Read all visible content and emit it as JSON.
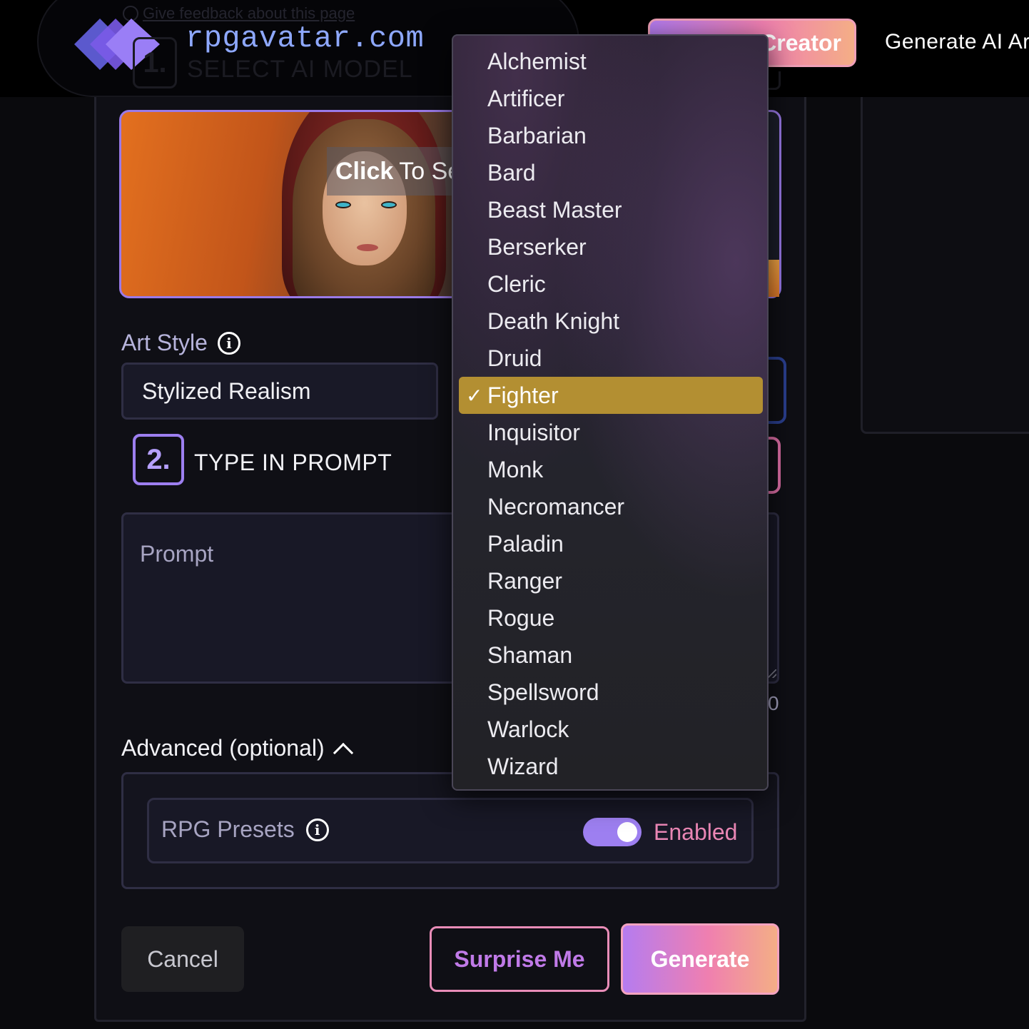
{
  "header": {
    "feedback_link": "Give feedback about this page",
    "logo_text": "rpgavatar.com",
    "ghost_step_number": "1.",
    "ghost_step_title": "SELECT AI MODEL",
    "creator_button": "Creator",
    "generate_ai_link": "Generate AI Ar"
  },
  "model": {
    "click_bold": "Click",
    "click_rest": "To Se"
  },
  "art_style": {
    "label": "Art Style",
    "value": "Stylized Realism"
  },
  "step2": {
    "number": "2.",
    "title": "TYPE IN PROMPT"
  },
  "prompt": {
    "placeholder": "Prompt",
    "char_count": "0"
  },
  "advanced": {
    "label": "Advanced (optional)",
    "presets_label": "RPG Presets",
    "toggle_state": "Enabled"
  },
  "buttons": {
    "cancel": "Cancel",
    "surprise": "Surprise Me",
    "generate": "Generate"
  },
  "class_dropdown": {
    "selected": "Fighter",
    "check_glyph": "✓",
    "options": [
      "Alchemist",
      "Artificer",
      "Barbarian",
      "Bard",
      "Beast Master",
      "Berserker",
      "Cleric",
      "Death Knight",
      "Druid",
      "Fighter",
      "Inquisitor",
      "Monk",
      "Necromancer",
      "Paladin",
      "Ranger",
      "Rogue",
      "Shaman",
      "Spellsword",
      "Warlock",
      "Wizard"
    ]
  },
  "colors": {
    "accent_purple": "#9d7ff0",
    "accent_pink": "#ef7fb0",
    "selected_option": "#b38f32",
    "logo_text": "#8ea8ff"
  }
}
